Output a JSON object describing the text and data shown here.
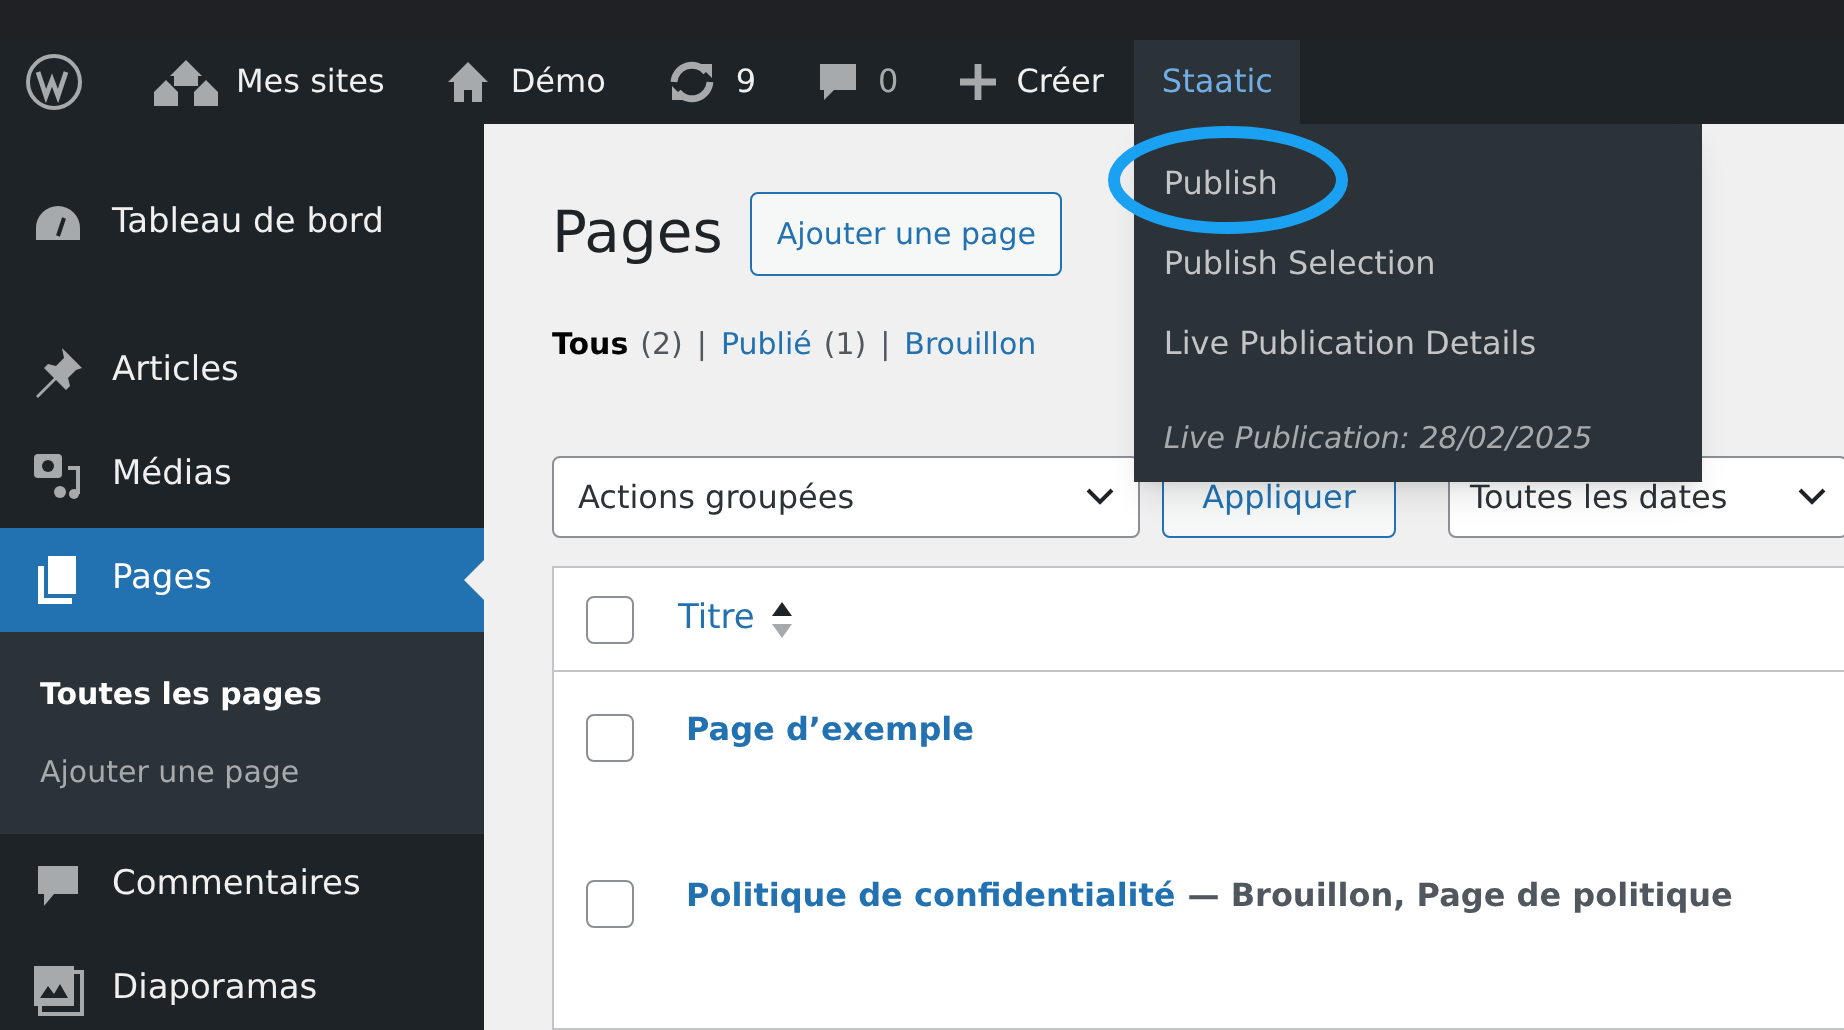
{
  "admin_bar": {
    "items": [
      {
        "kind": "logo"
      },
      {
        "kind": "sites",
        "label": "Mes sites"
      },
      {
        "kind": "home",
        "label": "Démo"
      },
      {
        "kind": "updates",
        "label": "9"
      },
      {
        "kind": "comments",
        "label": "0"
      },
      {
        "kind": "new",
        "label": "Créer"
      },
      {
        "kind": "plugin",
        "label": "Staatic",
        "expanded": true
      }
    ]
  },
  "plugin_menu": [
    {
      "kind": "link",
      "label": "Publish",
      "circled": true
    },
    {
      "kind": "link",
      "label": "Publish Selection",
      "circled": false
    },
    {
      "kind": "link",
      "label": "Live Publication Details",
      "circled": false
    },
    {
      "kind": "note",
      "label": "Live Publication: 28/02/2025",
      "circled": false
    }
  ],
  "sidebar": {
    "items": [
      {
        "kind": "dashboard",
        "label": "Tableau de bord",
        "selected": false
      },
      {
        "kind": "pin",
        "label": "Articles",
        "selected": false
      },
      {
        "kind": "media",
        "label": "Médias",
        "selected": false
      },
      {
        "kind": "pages",
        "label": "Pages",
        "selected": true,
        "children": [
          {
            "label": "Toutes les pages",
            "selected": true
          },
          {
            "label": "Ajouter une page",
            "selected": false
          }
        ]
      },
      {
        "kind": "comments",
        "label": "Commentaires",
        "selected": false
      },
      {
        "kind": "gallery",
        "label": "Diaporamas",
        "selected": false
      }
    ]
  },
  "page": {
    "title": "Pages",
    "add_button": "Ajouter une page",
    "filters": [
      {
        "label": "Tous",
        "count": "(2)",
        "selected": true
      },
      {
        "separator": "|",
        "label": "Publié",
        "count": "(1)",
        "selected": false
      },
      {
        "separator": "|",
        "label": "Brouillon",
        "selected": false
      }
    ],
    "bulk_select": "Actions groupées",
    "apply_button": "Appliquer",
    "date_select": "Toutes les dates",
    "table": {
      "select_all_checked": false,
      "columns": [
        {
          "label": "Titre"
        }
      ],
      "rows": [
        {
          "title": "Page d’exemple",
          "checked": false
        },
        {
          "title": "Politique de confidentialité",
          "state": "— Brouillon, Page de politique",
          "checked": false
        }
      ]
    }
  }
}
